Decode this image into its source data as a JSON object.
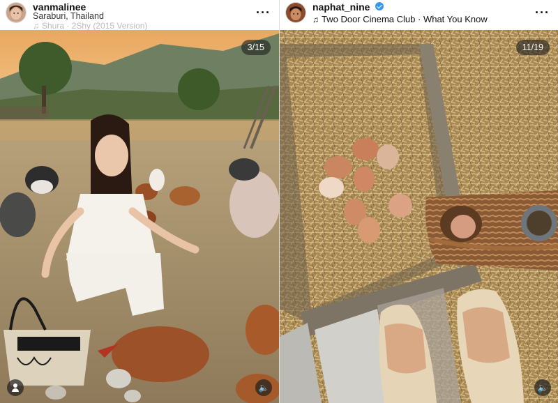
{
  "left_post": {
    "username": "vanmalinee",
    "location": "Saraburi, Thailand",
    "audio": "Shura · 2Shy (2015 Version)",
    "counter": "3/15",
    "more_icon": "more-horizontal-icon",
    "tag_icon": "user-tag-icon",
    "audio_icon": "speaker-icon"
  },
  "right_post": {
    "username": "naphat_nine",
    "verified": true,
    "audio": "Two Door Cinema Club · What You Know",
    "counter": "11/19",
    "more_icon": "more-horizontal-icon",
    "audio_icon": "speaker-icon"
  },
  "colors": {
    "verified": "#3897f0",
    "badge_bg": "#1e1e1e"
  }
}
